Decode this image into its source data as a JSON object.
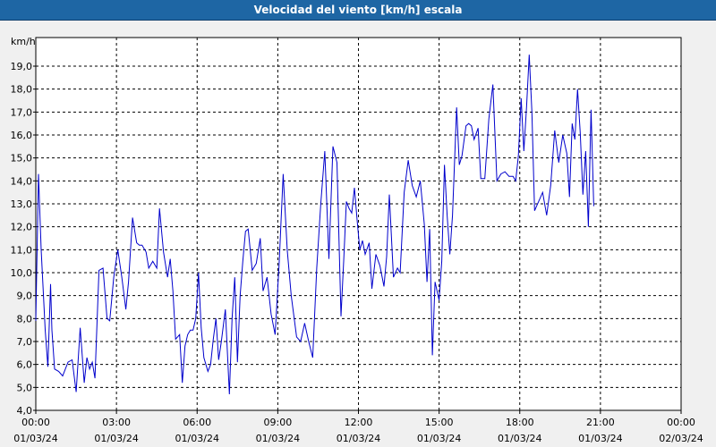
{
  "window": {
    "title": "Velocidad del viento [km/h] escala"
  },
  "colors": {
    "line": "#0000cc",
    "title_bar": "#1e66a4",
    "grid": "#000000"
  },
  "chart_data": {
    "type": "line",
    "title": "Velocidad del viento [km/h] escala",
    "ylabel": "km/h",
    "xlabel": "",
    "ylim": [
      4.0,
      20.0
    ],
    "y_ticks": [
      "4,0",
      "5,0",
      "6,0",
      "7,0",
      "8,0",
      "9,0",
      "10,0",
      "11,0",
      "12,0",
      "13,0",
      "14,0",
      "15,0",
      "16,0",
      "17,0",
      "18,0",
      "19,0"
    ],
    "xlim_hours": [
      0,
      24
    ],
    "x_ticks": [
      {
        "time": "00:00",
        "date": "01/03/24"
      },
      {
        "time": "03:00",
        "date": "01/03/24"
      },
      {
        "time": "06:00",
        "date": "01/03/24"
      },
      {
        "time": "09:00",
        "date": "01/03/24"
      },
      {
        "time": "12:00",
        "date": "01/03/24"
      },
      {
        "time": "15:00",
        "date": "01/03/24"
      },
      {
        "time": "18:00",
        "date": "01/03/24"
      },
      {
        "time": "21:00",
        "date": "01/03/24"
      },
      {
        "time": "00:00",
        "date": "02/03/24"
      }
    ],
    "grid": true,
    "series": [
      {
        "name": "",
        "x_hours": [
          0.0,
          0.1,
          0.2,
          0.35,
          0.45,
          0.55,
          0.6,
          0.7,
          0.85,
          1.0,
          1.2,
          1.35,
          1.5,
          1.65,
          1.8,
          1.9,
          2.0,
          2.1,
          2.2,
          2.35,
          2.5,
          2.65,
          2.75,
          2.9,
          3.05,
          3.2,
          3.35,
          3.45,
          3.6,
          3.75,
          3.85,
          3.95,
          4.1,
          4.2,
          4.35,
          4.5,
          4.6,
          4.75,
          4.9,
          5.0,
          5.1,
          5.2,
          5.35,
          5.45,
          5.55,
          5.65,
          5.75,
          5.85,
          5.95,
          6.05,
          6.15,
          6.25,
          6.4,
          6.5,
          6.6,
          6.7,
          6.8,
          6.9,
          7.05,
          7.2,
          7.3,
          7.4,
          7.5,
          7.6,
          7.7,
          7.8,
          7.9,
          8.05,
          8.2,
          8.35,
          8.45,
          8.6,
          8.75,
          8.9,
          9.05,
          9.2,
          9.35,
          9.5,
          9.7,
          9.85,
          10.0,
          10.15,
          10.3,
          10.45,
          10.6,
          10.75,
          10.9,
          11.05,
          11.2,
          11.35,
          11.45,
          11.55,
          11.65,
          11.75,
          11.85,
          11.95,
          12.05,
          12.15,
          12.25,
          12.4,
          12.5,
          12.65,
          12.8,
          12.95,
          13.05,
          13.15,
          13.3,
          13.45,
          13.55,
          13.7,
          13.85,
          14.0,
          14.15,
          14.3,
          14.45,
          14.55,
          14.65,
          14.75,
          14.85,
          15.0,
          15.1,
          15.2,
          15.3,
          15.4,
          15.5,
          15.65,
          15.75,
          15.85,
          16.0,
          16.1,
          16.2,
          16.3,
          16.45,
          16.55,
          16.7,
          16.85,
          17.0,
          17.15,
          17.3,
          17.45,
          17.6,
          17.75,
          17.85,
          17.95,
          18.05,
          18.15,
          18.25,
          18.35,
          18.45,
          18.55,
          18.7,
          18.85,
          19.0,
          19.15,
          19.3,
          19.45,
          19.6,
          19.75,
          19.85,
          19.95,
          20.05,
          20.15,
          20.25,
          20.35,
          20.45,
          20.55,
          20.65,
          20.75,
          20.85,
          21.0,
          21.15,
          21.3,
          21.45,
          21.6,
          21.75,
          21.85,
          21.95,
          22.05,
          22.15,
          22.25,
          22.35,
          22.45,
          22.55,
          22.65,
          22.75,
          22.85,
          22.95,
          23.05,
          23.15,
          23.25,
          23.35,
          23.45,
          23.55,
          23.65,
          23.75,
          23.85
        ],
        "values": [
          7.9,
          14.3,
          11.0,
          7.5,
          5.9,
          9.5,
          7.5,
          5.8,
          5.7,
          5.5,
          6.1,
          6.2,
          4.8,
          7.6,
          5.2,
          6.3,
          5.8,
          6.1,
          5.4,
          10.1,
          10.2,
          8.0,
          7.9,
          9.8,
          11.0,
          9.8,
          8.4,
          9.6,
          12.4,
          11.3,
          11.2,
          11.2,
          10.9,
          10.2,
          10.5,
          10.2,
          12.8,
          10.9,
          9.8,
          10.6,
          9.2,
          7.1,
          7.3,
          5.2,
          6.8,
          7.3,
          7.5,
          7.5,
          8.0,
          10.0,
          7.6,
          6.3,
          5.7,
          6.0,
          7.1,
          8.0,
          6.2,
          7.0,
          8.4,
          4.7,
          8.0,
          9.8,
          6.1,
          9.0,
          10.5,
          11.8,
          11.9,
          10.1,
          10.4,
          11.5,
          9.2,
          9.8,
          8.2,
          7.3,
          10.4,
          14.3,
          11.0,
          9.0,
          7.2,
          7.0,
          7.8,
          7.0,
          6.3,
          10.2,
          13.0,
          15.3,
          10.6,
          15.5,
          14.8,
          8.1,
          10.5,
          13.1,
          12.8,
          12.6,
          13.7,
          12.3,
          11.0,
          11.4,
          10.8,
          11.3,
          9.3,
          10.8,
          10.3,
          9.4,
          10.7,
          13.4,
          9.8,
          10.2,
          10.0,
          13.5,
          14.9,
          13.8,
          13.3,
          14.0,
          12.1,
          9.6,
          11.9,
          6.4,
          9.6,
          8.8,
          10.5,
          14.7,
          12.5,
          10.8,
          12.5,
          17.2,
          14.7,
          15.1,
          16.4,
          16.5,
          16.4,
          15.8,
          16.3,
          14.1,
          14.1,
          16.7,
          18.2,
          14.0,
          14.3,
          14.4,
          14.2,
          14.2,
          14.0,
          15.1,
          17.6,
          15.3,
          17.2,
          19.5,
          17.0,
          12.7,
          13.1,
          13.5,
          12.5,
          13.8,
          16.2,
          14.8,
          16.0,
          15.2,
          13.3,
          16.5,
          15.8,
          18.0,
          16.1,
          13.4,
          15.3,
          12.0,
          17.1,
          12.9
        ]
      }
    ]
  }
}
